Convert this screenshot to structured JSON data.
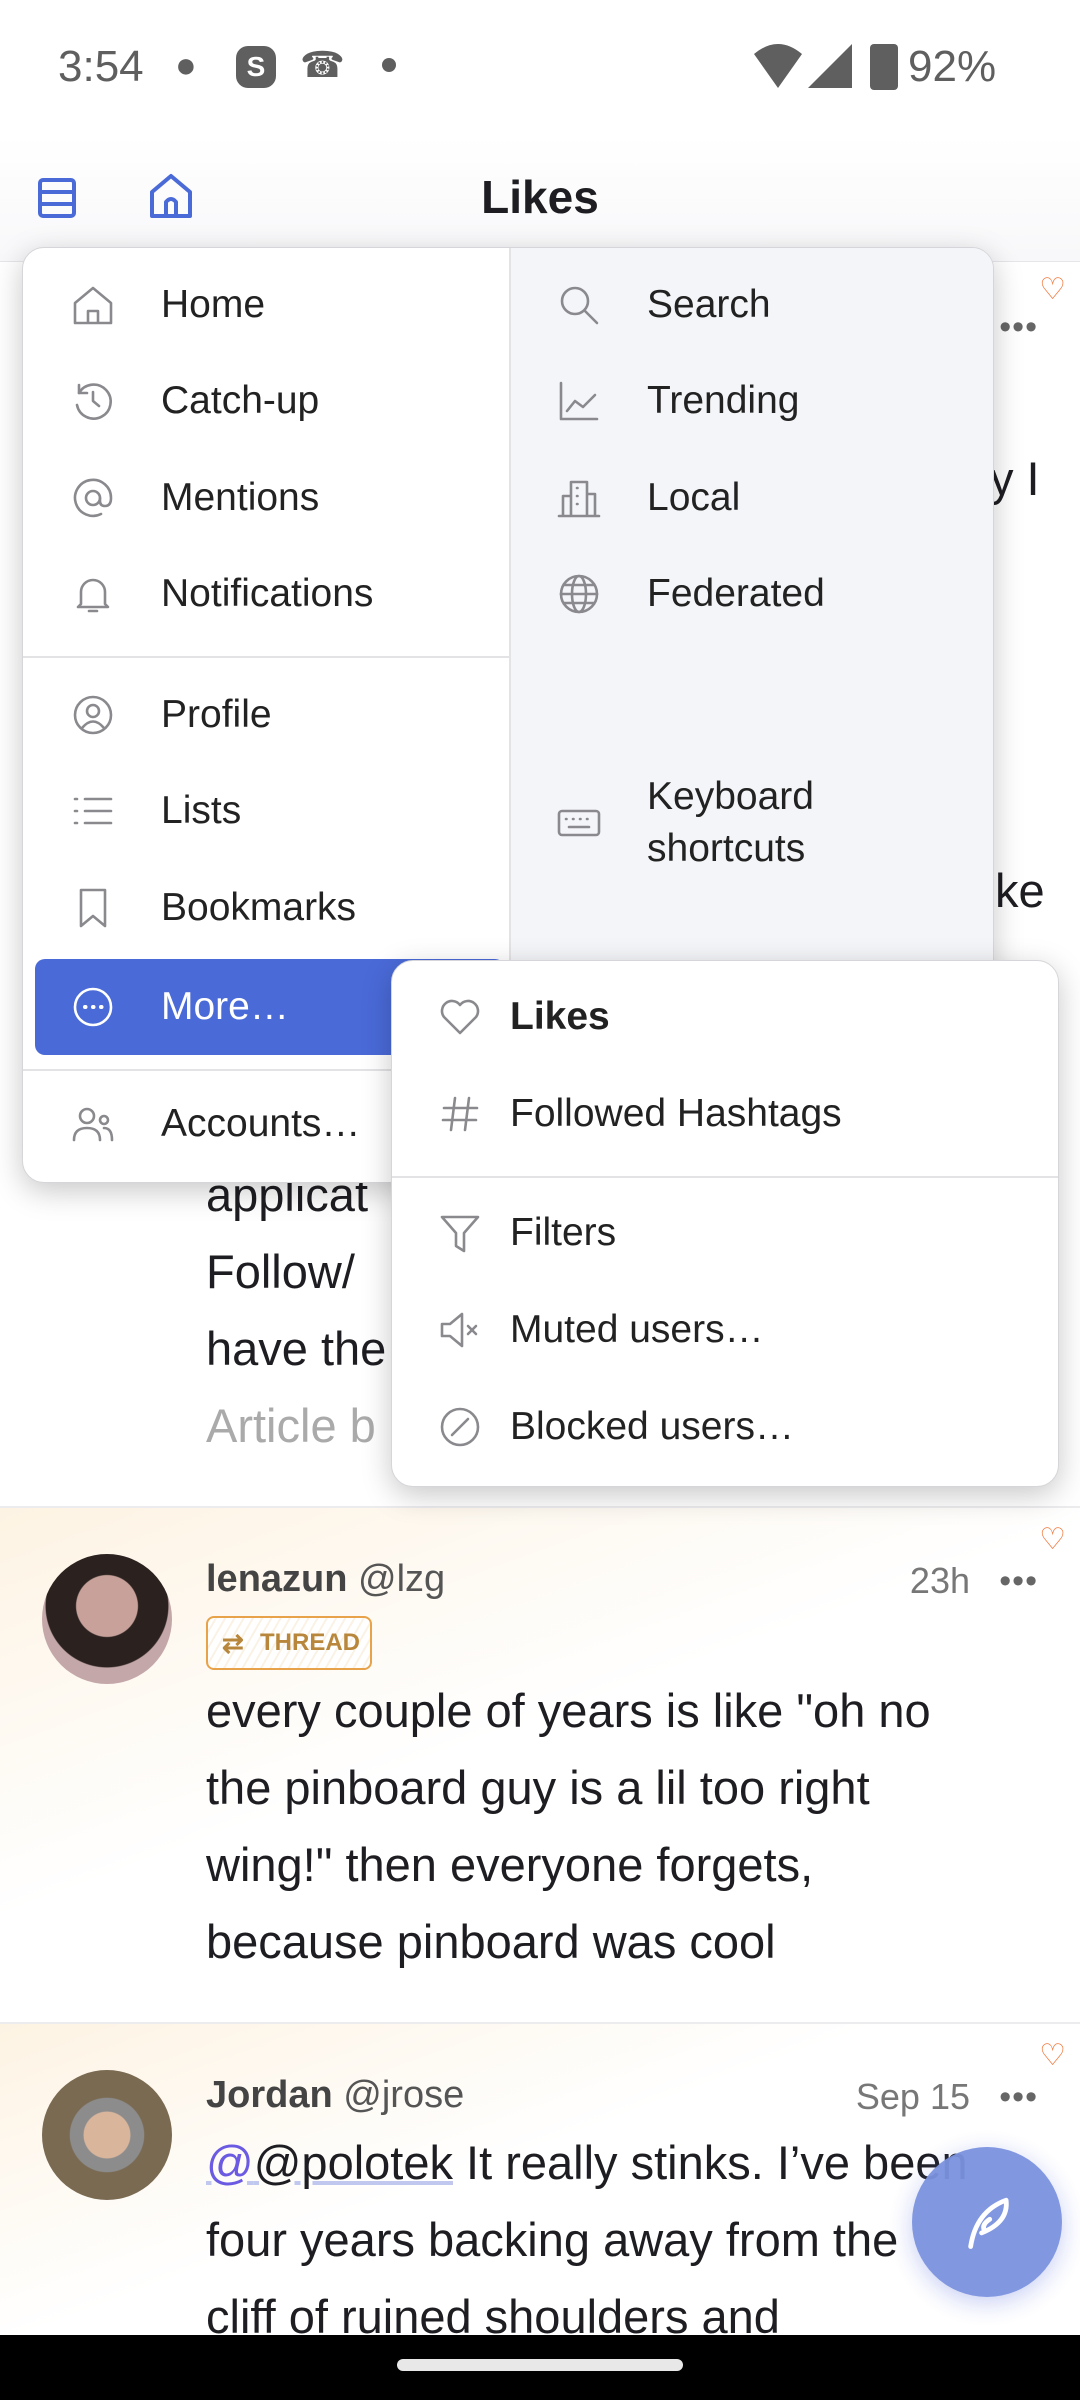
{
  "status_bar": {
    "time": "3:54",
    "battery": "92%",
    "icons": [
      "chat-bubble-icon",
      "skype-icon",
      "missed-call-icon",
      "dot-icon",
      "wifi-icon",
      "signal-icon",
      "battery-icon"
    ]
  },
  "header": {
    "title": "Likes",
    "icons": [
      "columns-icon",
      "home-icon"
    ]
  },
  "menu": {
    "left": [
      {
        "label": "Home",
        "icon": "home-icon"
      },
      {
        "label": "Catch-up",
        "icon": "catch-up-icon"
      },
      {
        "label": "Mentions",
        "icon": "at-icon"
      },
      {
        "label": "Notifications",
        "icon": "bell-icon"
      },
      {
        "label": "Profile",
        "icon": "profile-icon"
      },
      {
        "label": "Lists",
        "icon": "list-icon"
      },
      {
        "label": "Bookmarks",
        "icon": "bookmark-icon"
      },
      {
        "label": "More…",
        "icon": "more-icon"
      },
      {
        "label": "Accounts…",
        "icon": "accounts-icon"
      }
    ],
    "right": [
      {
        "label": "Search",
        "icon": "search-icon"
      },
      {
        "label": "Trending",
        "icon": "trending-icon"
      },
      {
        "label": "Local",
        "icon": "building-icon"
      },
      {
        "label": "Federated",
        "icon": "globe-icon"
      },
      {
        "label": "Keyboard shortcuts",
        "icon": "keyboard-icon"
      }
    ],
    "submenu": [
      {
        "label": "Likes",
        "icon": "heart-icon"
      },
      {
        "label": "Followed Hashtags",
        "icon": "hashtag-icon"
      },
      {
        "label": "Filters",
        "icon": "filter-icon"
      },
      {
        "label": "Muted users…",
        "icon": "mute-icon"
      },
      {
        "label": "Blocked users…",
        "icon": "block-icon"
      }
    ],
    "accent": "#4a6ad8"
  },
  "background_post": {
    "fragments": [
      "y I",
      "ke",
      "applicat",
      "Follow/",
      "have the",
      "Article b"
    ]
  },
  "posts": [
    {
      "name": "lenazun",
      "handle": "@lzg",
      "time": "23h",
      "badge": "THREAD",
      "text": [
        "every couple of years is like \"oh no",
        "the pinboard guy is a lil too right",
        "wing!\" then everyone forgets,",
        "because pinboard was cool"
      ]
    },
    {
      "name": "Jordan",
      "handle": "@jrose",
      "time": "Sep 15",
      "mention": "@polotek",
      "text_first": " It really stinks. I’ve been",
      "text": [
        "four years backing away from the",
        "cliff of ruined shoulders and"
      ]
    }
  ],
  "fab": {
    "icon": "feather-compose-icon",
    "color": "#7b93e0"
  },
  "colors": {
    "heart": "#f07a3f",
    "badge": "#e8a24a",
    "mention": "#6a5be2"
  }
}
